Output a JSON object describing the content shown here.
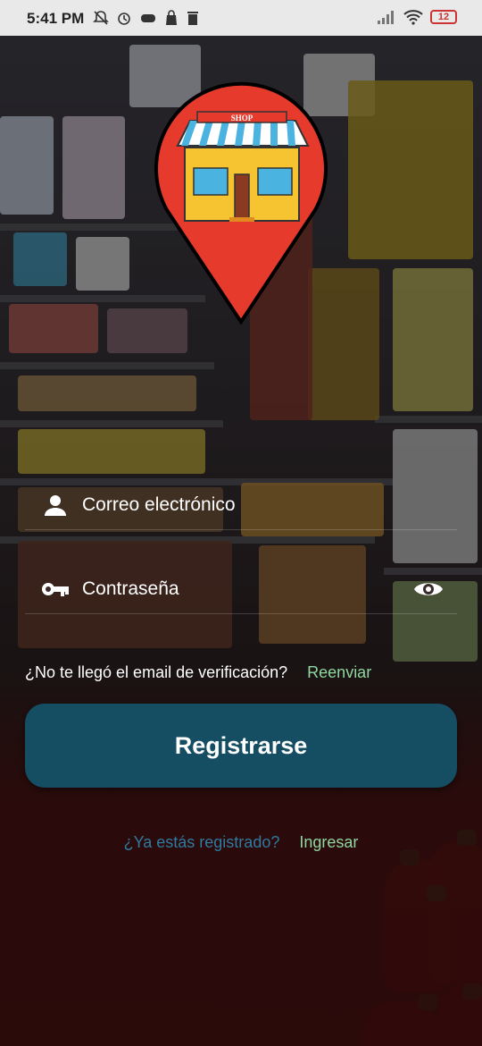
{
  "status_bar": {
    "time": "5:41 PM",
    "battery": "12",
    "icons": [
      "muted-bell-icon",
      "alarm-icon",
      "game-controller-icon",
      "shopping-bag-icon",
      "trash-icon",
      "signal-icon",
      "wifi-icon",
      "battery-icon"
    ]
  },
  "logo": {
    "sign_text": "SHOP"
  },
  "form": {
    "email_label": "Correo electrónico",
    "password_label": "Contraseña"
  },
  "verify": {
    "question": "¿No te llegó el email de verificación?",
    "resend_link": "Reenviar"
  },
  "register_button": "Registrarse",
  "login_prompt": {
    "question": "¿Ya estás registrado?",
    "login_link": "Ingresar"
  },
  "colors": {
    "button": "#154d63",
    "link_green": "#8fd6a0",
    "link_blue": "#2f7aa0",
    "pin_red": "#e53a2c"
  }
}
